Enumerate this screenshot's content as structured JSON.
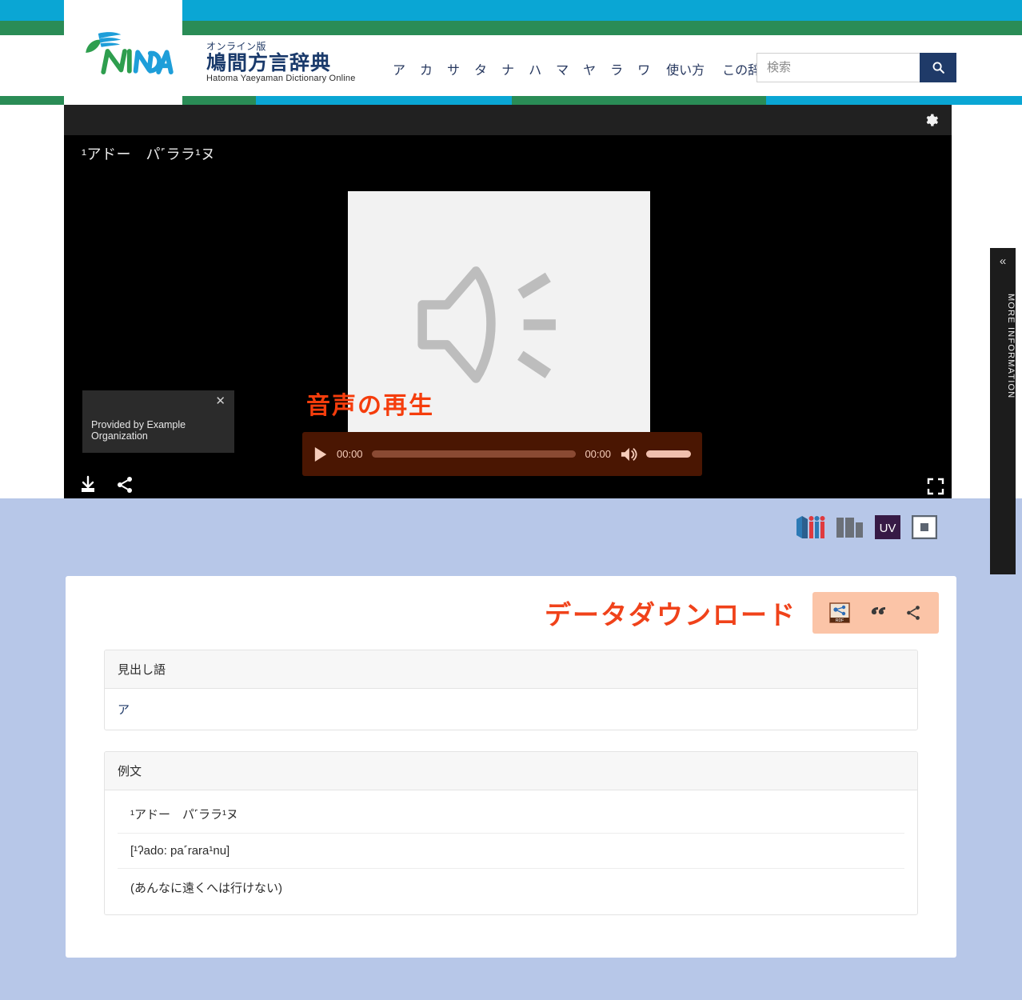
{
  "header": {
    "logo_text": "NINDA",
    "brand_small": "オンライン版",
    "brand_main": "鳩間方言辞典",
    "brand_en": "Hatoma Yaeyaman Dictionary Online",
    "nav": [
      {
        "label": "ア"
      },
      {
        "label": "カ"
      },
      {
        "label": "サ"
      },
      {
        "label": "タ"
      },
      {
        "label": "ナ"
      },
      {
        "label": "ハ"
      },
      {
        "label": "マ"
      },
      {
        "label": "ヤ"
      },
      {
        "label": "ラ"
      },
      {
        "label": "ワ"
      },
      {
        "label": "使い方"
      },
      {
        "label": "この辞典について"
      }
    ],
    "search": {
      "placeholder": "検索",
      "value": "",
      "icon": "search-icon"
    },
    "colors": {
      "cyan": "#0aa6d4",
      "green": "#2a8c56",
      "navy": "#1f3a68"
    }
  },
  "viewer": {
    "settings_icon": "gear-icon",
    "title": "¹アドー　パ˹ララ¹ヌ",
    "thumbnail_icon": "speaker-icon",
    "attribution": {
      "text": "Provided by Example Organization",
      "close_icon": "close-icon"
    },
    "audio_player": {
      "play_icon": "play-icon",
      "current_time": "00:00",
      "duration": "00:00",
      "volume_icon": "volume-icon"
    },
    "bottom_icons": [
      {
        "name": "download-icon"
      },
      {
        "name": "share-icon"
      }
    ],
    "fullscreen_icon": "fullscreen-icon",
    "more_information": {
      "label": "MORE INFORMATION",
      "chevron": "«"
    }
  },
  "annotations": {
    "audio_play": "音声の再生",
    "data_download": "データダウンロード"
  },
  "iiif_bar": [
    {
      "name": "iiif-logo-icon",
      "label": "IIIF"
    },
    {
      "name": "mirador-icon",
      "label": "Mirador"
    },
    {
      "name": "universal-viewer-icon",
      "label": "UV"
    },
    {
      "name": "curation-viewer-icon",
      "label": "Curation"
    }
  ],
  "card": {
    "tools": [
      {
        "name": "rdf-icon",
        "label": "RDF"
      },
      {
        "name": "quote-icon",
        "label": "”"
      },
      {
        "name": "share-icon",
        "label": "share"
      }
    ],
    "tables": [
      {
        "header": "見出し語",
        "rows": [
          {
            "text": "ア",
            "link": true
          }
        ]
      },
      {
        "header": "例文",
        "rows": [
          {
            "text": "¹アドー　パ˹ララ¹ヌ",
            "link": false
          },
          {
            "text": "[¹ʔado: pa˹rara¹nu]",
            "link": false
          },
          {
            "text": "(あんなに遠くへは行けない)",
            "link": false
          }
        ]
      }
    ]
  }
}
